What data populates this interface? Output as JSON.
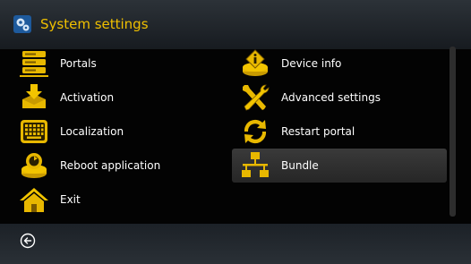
{
  "header": {
    "title": "System settings",
    "icon": "gear-settings-icon",
    "accent_color": "#f0c000"
  },
  "menu": {
    "left": [
      {
        "label": "Portals",
        "icon": "server-stack-icon"
      },
      {
        "label": "Activation",
        "icon": "download-box-icon"
      },
      {
        "label": "Localization",
        "icon": "keyboard-icon"
      },
      {
        "label": "Reboot application",
        "icon": "reboot-icon"
      },
      {
        "label": "Exit",
        "icon": "home-icon"
      }
    ],
    "right": [
      {
        "label": "Device info",
        "icon": "info-icon"
      },
      {
        "label": "Advanced settings",
        "icon": "tools-icon"
      },
      {
        "label": "Restart portal",
        "icon": "restart-arrows-icon"
      },
      {
        "label": "Bundle",
        "icon": "network-icon",
        "selected": true
      }
    ]
  },
  "footer": {
    "back_icon": "back-arrow-icon"
  }
}
